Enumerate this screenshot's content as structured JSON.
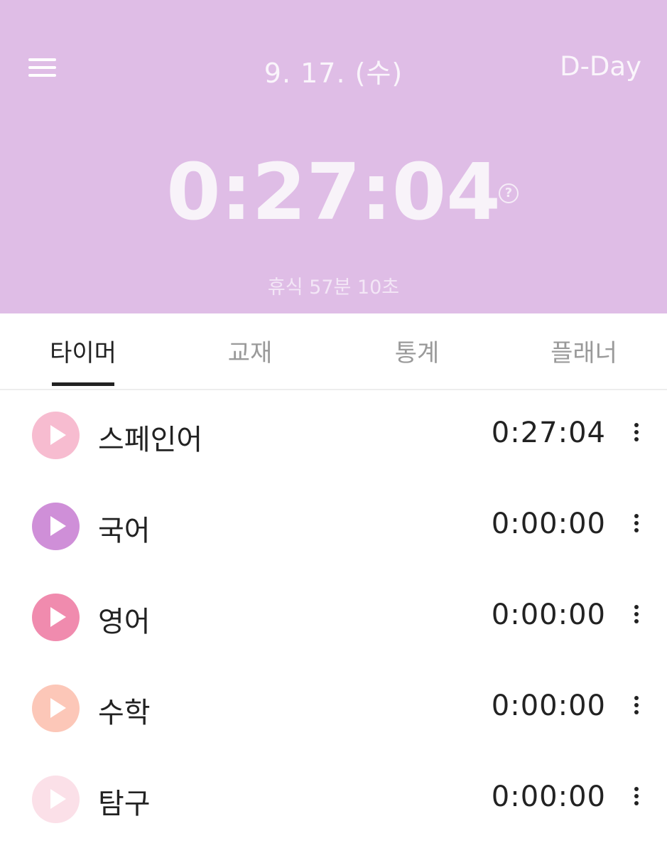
{
  "header": {
    "date": "9. 17. (수)",
    "dday_label": "D-Day",
    "timer": "0:27:04",
    "help_symbol": "?",
    "rest_text": "휴식 57분 10초",
    "bg_color": "#dfbde6"
  },
  "tabs": [
    {
      "label": "타이머",
      "active": true
    },
    {
      "label": "교재",
      "active": false
    },
    {
      "label": "통계",
      "active": false
    },
    {
      "label": "플래너",
      "active": false
    }
  ],
  "subjects": [
    {
      "name": "스페인어",
      "time": "0:27:04",
      "color": "#f7bcd0"
    },
    {
      "name": "국어",
      "time": "0:00:00",
      "color": "#cf8fd8"
    },
    {
      "name": "영어",
      "time": "0:00:00",
      "color": "#f08bae"
    },
    {
      "name": "수학",
      "time": "0:00:00",
      "color": "#fcc7b8"
    },
    {
      "name": "탐구",
      "time": "0:00:00",
      "color": "#fbe0e8"
    }
  ]
}
